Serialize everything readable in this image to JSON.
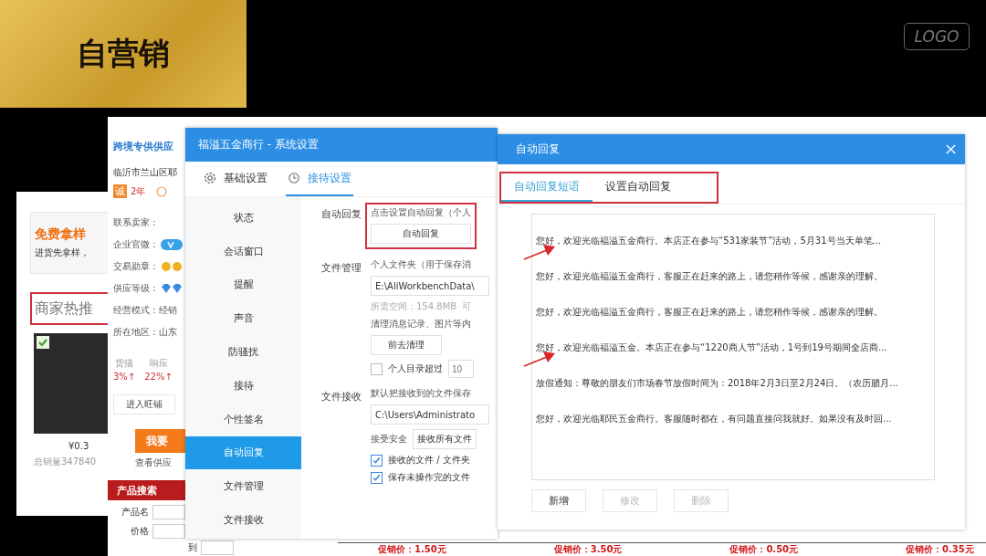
{
  "slide": {
    "title": "自营销",
    "logo": "LOGO"
  },
  "back_page": {
    "banner_title": "免费拿样",
    "banner_text": "进货先拿样，",
    "section_title": "商家热推",
    "section_highlighted": true,
    "product": {
      "price": "¥0.3",
      "sales": "总销量347840",
      "checked": true
    }
  },
  "store_page": {
    "store_name": "跨境专供供应",
    "address": "临沂市兰山区耶",
    "badge": "诚",
    "years": "2年",
    "info": [
      {
        "label": "联系卖家：",
        "kind": "text"
      },
      {
        "label": "企业官微：",
        "kind": "weibo"
      },
      {
        "label": "交易勋章：",
        "kind": "medal"
      },
      {
        "label": "供应等级：",
        "kind": "diamond"
      },
      {
        "label": "经营模式：经销",
        "kind": "text"
      },
      {
        "label": "所在地区：山东",
        "kind": "text"
      }
    ],
    "ratings": [
      {
        "label": "货描",
        "value": "3%↑"
      },
      {
        "label": "响应",
        "value": "22%↑"
      }
    ],
    "shop_button": "进入旺铺",
    "contact_button": "我要",
    "supplier_link": "查看供应",
    "search_title": "产品搜索",
    "name_label": "产品名",
    "price_label": "价格",
    "range_separator": "到"
  },
  "settings_window": {
    "title": "福溢五金商行 - 系统设置",
    "tabs": [
      {
        "label": "基础设置",
        "kind": "gear",
        "selected": false
      },
      {
        "label": "接待设置",
        "kind": "clock",
        "selected": true
      }
    ],
    "sidebar": [
      {
        "label": "状态",
        "selected": false
      },
      {
        "label": "会话窗口",
        "selected": false
      },
      {
        "label": "提醒",
        "selected": false
      },
      {
        "label": "声音",
        "selected": false
      },
      {
        "label": "防骚扰",
        "selected": false
      },
      {
        "label": "接待",
        "selected": false
      },
      {
        "label": "个性签名",
        "selected": false
      },
      {
        "label": "自动回复",
        "selected": true
      },
      {
        "label": "文件管理",
        "selected": false
      },
      {
        "label": "文件接收",
        "selected": false
      }
    ],
    "auto_reply": {
      "label": "自动回复",
      "hint": "点击设置自动回复（个人",
      "button": "自动回复",
      "highlighted": true
    },
    "file_management": {
      "label": "文件管理",
      "hint": "个人文件夹（用于保存消",
      "path": "E:\\AliWorkbenchData\\",
      "space": "所需空间：154.8MB",
      "space_more": "可",
      "clean_hint": "清理消息记录、图片等内",
      "clean_button": "前去清理",
      "limit": {
        "label": "个人目录超过",
        "checked": false,
        "placeholder": "10"
      }
    },
    "file_receive": {
      "label": "文件接收",
      "hint": "默认把接收到的文件保存",
      "path": "C:\\Users\\Administrato",
      "security_label": "接受安全",
      "security_value": "接收所有文件",
      "options": [
        {
          "label": "接收的文件 / 文件夹",
          "checked": true
        },
        {
          "label": "保存未操作完的文件",
          "checked": true
        }
      ]
    }
  },
  "auto_reply_dialog": {
    "title": "自动回复",
    "tabs_highlighted": true,
    "tabs": [
      {
        "label": "自动回复短语",
        "selected": true
      },
      {
        "label": "设置自动回复",
        "selected": false
      }
    ],
    "phrases": [
      {
        "text": "您好，欢迎光临福溢五金商行。本店正在参与“531家装节”活动，5月31号当天单笔...",
        "marked": true
      },
      {
        "text": "您好，欢迎光临福溢五金商行，客服正在赶来的路上，请您稍作等候，感谢亲的理解。",
        "marked": false
      },
      {
        "text": "您好，欢迎光临福溢五金商行，客服正在赶来的路上，请您稍作等候，感谢亲的理解。",
        "marked": false
      },
      {
        "text": "您好，欢迎光临福溢五金。本店正在参与“1220商人节”活动，1号到19号期间全店商...",
        "marked": true
      },
      {
        "text": "放假通知：尊敬的朋友们市场春节放假时间为：2018年2月3日至2月24日。（农历腊月...",
        "marked": false
      },
      {
        "text": "您好，欢迎光临耶民五金商行。客服随时都在，有问题直接问我就好。如果没有及时回...",
        "marked": false
      }
    ],
    "buttons": [
      {
        "label": "新增",
        "disabled": false
      },
      {
        "label": "修改",
        "disabled": true
      },
      {
        "label": "删除",
        "disabled": true
      }
    ]
  },
  "promo_prices": [
    "促销价：1.50元",
    "促销价：3.50元",
    "促销价：0.50元",
    "促销价：0.35元"
  ]
}
